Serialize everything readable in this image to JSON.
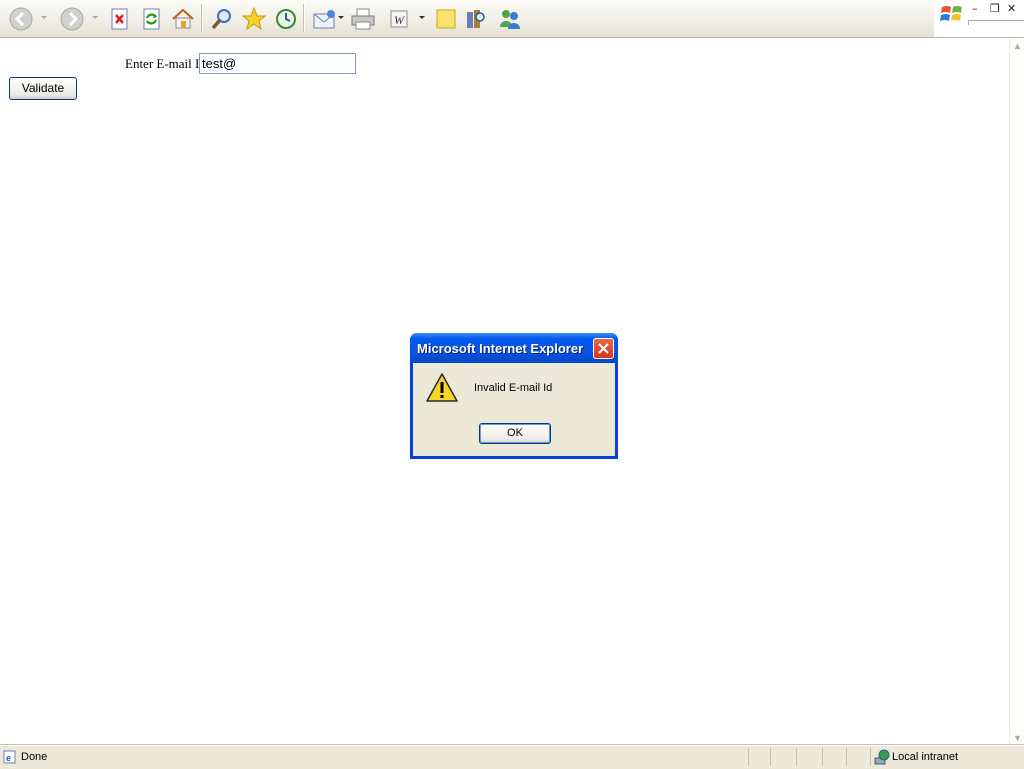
{
  "form": {
    "email_label": "Enter E-mail Id",
    "email_value": "test@",
    "validate_label": "Validate"
  },
  "dialog": {
    "title": "Microsoft Internet Explorer",
    "message": "Invalid E-mail Id",
    "ok_label": "OK"
  },
  "status": {
    "text": "Done",
    "zone": "Local intranet"
  },
  "colors": {
    "dialog_title_blue": "#0058ee",
    "dialog_close_red": "#d2381f",
    "chrome_beige": "#ece9d8"
  }
}
